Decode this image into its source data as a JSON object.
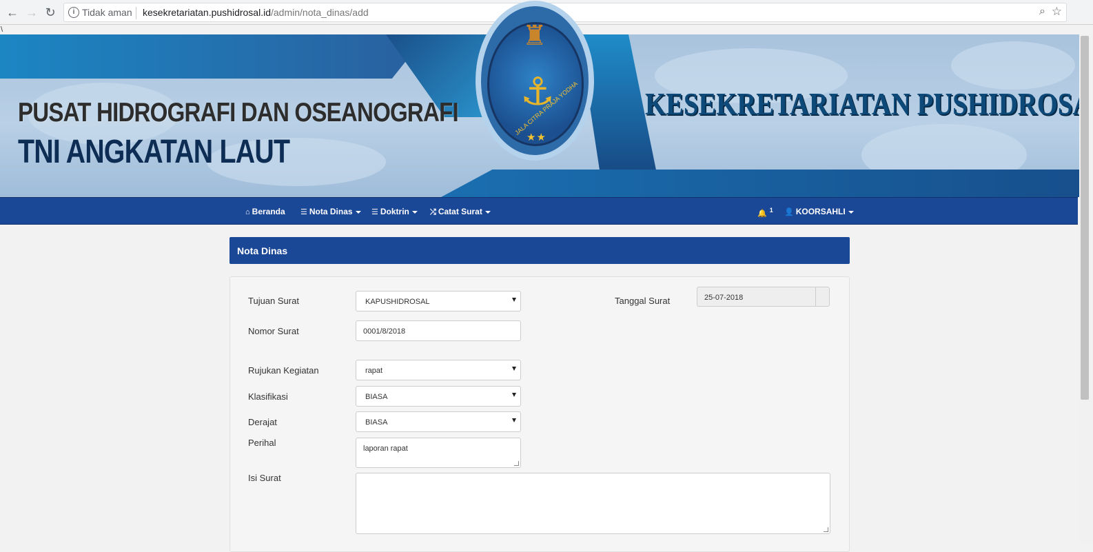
{
  "browser": {
    "security_label": "Tidak aman",
    "url_host": "kesekretariatan.pushidrosal.id",
    "url_path": "/admin/nota_dinas/add"
  },
  "stray_char": "\\",
  "banner": {
    "title_line1": "PUSAT HIDROGRAFI DAN OSEANOGRAFI",
    "title_line2": "TNI ANGKATAN LAUT",
    "title_right": "KESEKRETARIATAN PUSHIDROSAL",
    "motto": "JALA CITRA PRAJA YODHA"
  },
  "nav": {
    "items": [
      {
        "label": "Beranda",
        "icon": "home-icon"
      },
      {
        "label": "Nota Dinas",
        "icon": "list-icon",
        "dropdown": true
      },
      {
        "label": "Doktrin",
        "icon": "list-icon",
        "dropdown": true
      },
      {
        "label": "Catat Surat",
        "icon": "shuffle-icon",
        "dropdown": true
      }
    ],
    "notification_count": "1",
    "user_label": "KOORSAHLI"
  },
  "panel": {
    "title": "Nota Dinas"
  },
  "form": {
    "tujuan_label": "Tujuan Surat",
    "tujuan_value": "KAPUSHIDROSAL",
    "tanggal_label": "Tanggal Surat",
    "tanggal_value": "25-07-2018",
    "nomor_label": "Nomor Surat",
    "nomor_value": "0001/8/2018",
    "rujukan_label": "Rujukan Kegiatan",
    "rujukan_value": "rapat",
    "klasifikasi_label": "Klasifikasi",
    "klasifikasi_value": "BIASA",
    "derajat_label": "Derajat",
    "derajat_value": "BIASA",
    "perihal_label": "Perihal",
    "perihal_value": "laporan rapat",
    "isi_label": "Isi Surat",
    "isi_value": ""
  },
  "colors": {
    "navbar": "#1b4797",
    "page_bg": "#f2f2f2"
  }
}
